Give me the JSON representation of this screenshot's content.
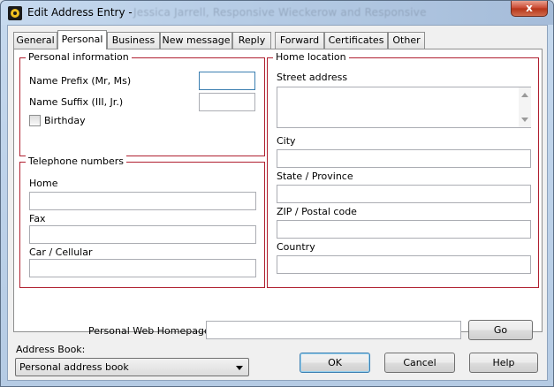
{
  "window": {
    "title": "Edit Address Entry -",
    "title_ghost": "Jessica Jarrell, Responsive Wieckerow and Responsive",
    "close_glyph": "x"
  },
  "tabs": [
    {
      "label": "General"
    },
    {
      "label": "Personal",
      "active": true
    },
    {
      "label": "Business"
    },
    {
      "label": "New message"
    },
    {
      "label": "Reply"
    },
    {
      "label": "Forward"
    },
    {
      "label": "Certificates"
    },
    {
      "label": "Other"
    }
  ],
  "personal_info": {
    "group_label": "Personal information",
    "name_prefix_label": "Name Prefix (Mr, Ms)",
    "name_prefix_value": "",
    "name_suffix_label": "Name Suffix (III, Jr.)",
    "name_suffix_value": "",
    "birthday_label": "Birthday",
    "birthday_checked": false
  },
  "telephone": {
    "group_label": "Telephone numbers",
    "home_label": "Home",
    "home_value": "",
    "fax_label": "Fax",
    "fax_value": "",
    "car_label": "Car / Cellular",
    "car_value": ""
  },
  "home_location": {
    "group_label": "Home location",
    "street_label": "Street address",
    "street_value": "",
    "city_label": "City",
    "city_value": "",
    "state_label": "State / Province",
    "state_value": "",
    "zip_label": "ZIP / Postal code",
    "zip_value": "",
    "country_label": "Country",
    "country_value": ""
  },
  "web": {
    "label": "Personal Web Homepage",
    "value": "",
    "go_label": "Go"
  },
  "address_book": {
    "label": "Address Book:",
    "selected": "Personal address book"
  },
  "buttons": {
    "ok": "OK",
    "cancel": "Cancel",
    "help": "Help"
  },
  "colors": {
    "group_border": "#b02030",
    "focus_border": "#3c7fb1"
  }
}
